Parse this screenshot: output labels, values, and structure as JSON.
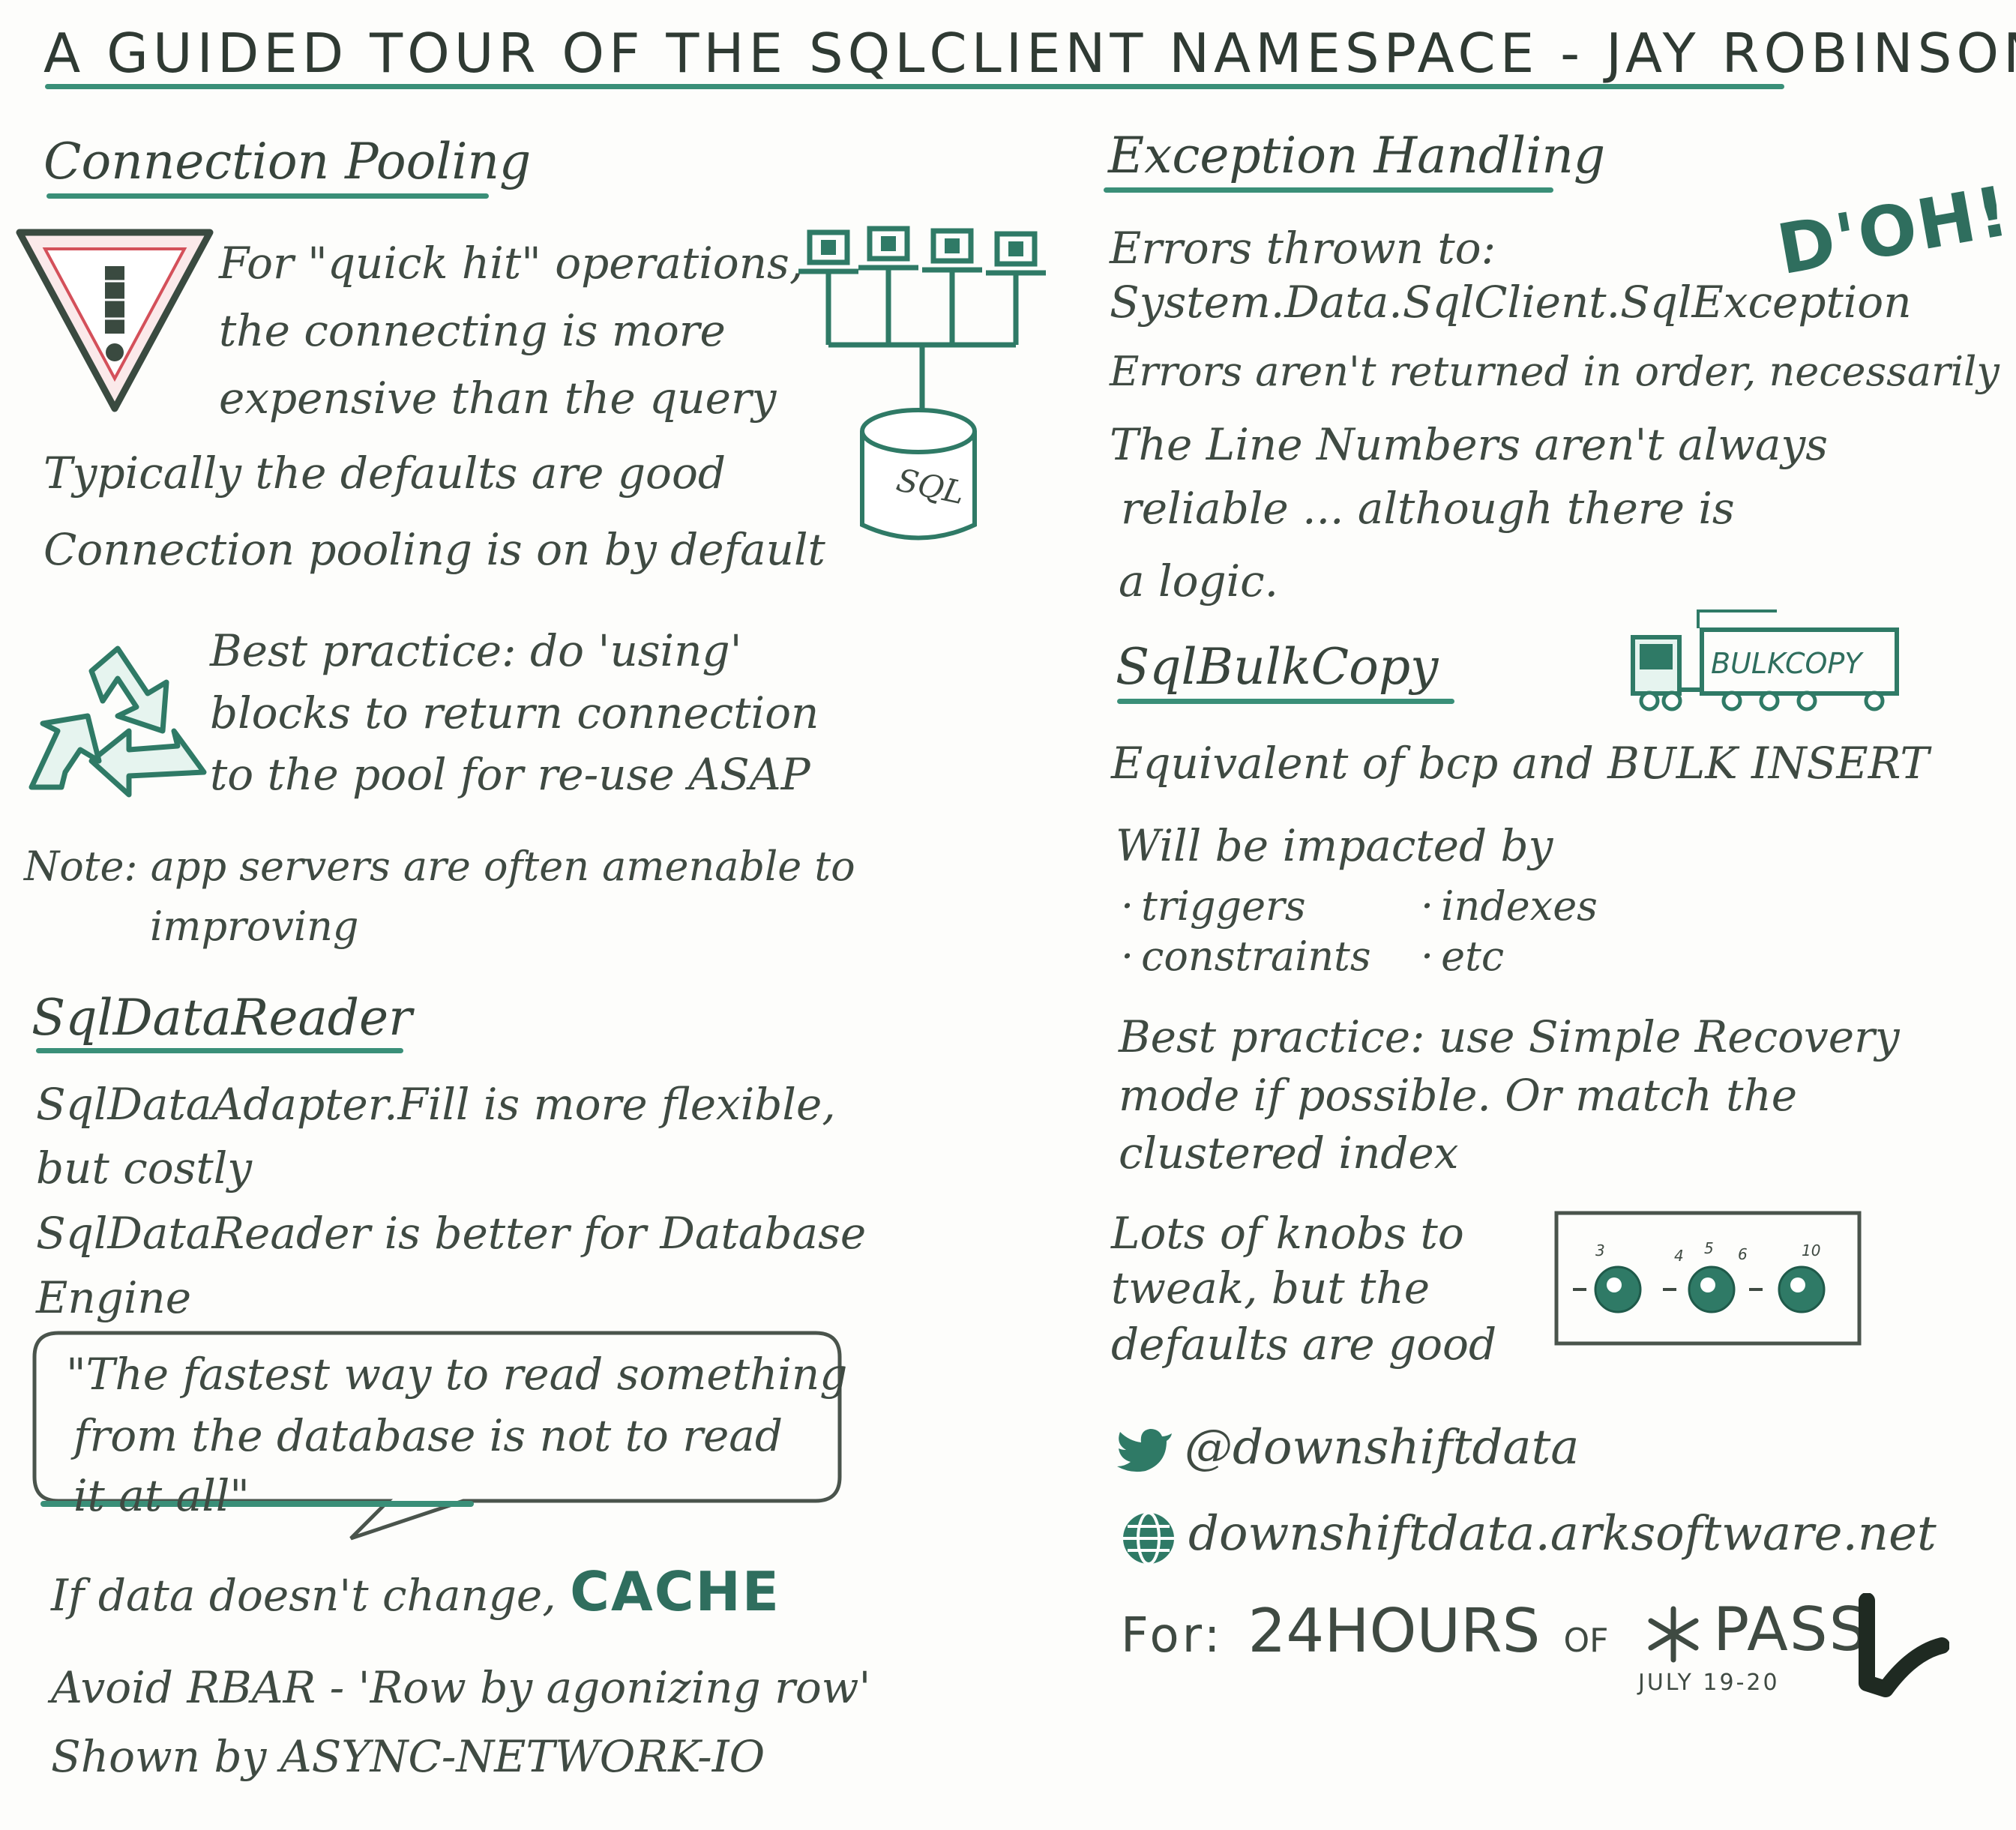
{
  "title": "A GUIDED TOUR OF THE SQLCLIENT NAMESPACE - JAY ROBINSON",
  "left": {
    "pooling": {
      "heading": "Connection Pooling",
      "quick_hit": [
        "For \"quick hit\" operations,",
        "the connecting is more",
        "expensive than the query"
      ],
      "defaults": "Typically the defaults are good",
      "on_default": "Connection pooling is on by default",
      "best_practice": [
        "Best practice: do 'using'",
        "blocks to return connection",
        "to the pool for re-use ASAP"
      ],
      "note": [
        "Note: app servers are often amenable to",
        "improving"
      ],
      "sql_label": "SQL"
    },
    "reader": {
      "heading": "SqlDataReader",
      "adapter": [
        "SqlDataAdapter.Fill is more flexible,",
        "but costly"
      ],
      "better": [
        "SqlDataReader is better for Database",
        "Engine"
      ],
      "quote": [
        "\"The fastest way to read something",
        "from the database is not to read",
        "it at all\""
      ],
      "cache_prefix": "If data doesn't change,",
      "cache_word": "CACHE",
      "rbar": "Avoid RBAR - 'Row by agonizing row'",
      "shown": "Shown by ASYNC-NETWORK-IO"
    }
  },
  "right": {
    "exceptions": {
      "heading": "Exception Handling",
      "doh": "D'OH!",
      "lines": [
        "Errors thrown to:",
        "System.Data.SqlClient.SqlException",
        "Errors aren't returned in order, necessarily",
        "The Line Numbers aren't always",
        "reliable ... although there is",
        "a logic."
      ]
    },
    "bulk": {
      "heading": "SqlBulkCopy",
      "truck_label": "BULKCOPY",
      "equivalent": "Equivalent of bcp and BULK INSERT",
      "impacted": "Will be impacted by",
      "items": [
        "triggers",
        "indexes",
        "constraints",
        "etc"
      ],
      "best_practice": [
        "Best practice: use Simple Recovery",
        "mode if possible. Or match the",
        "clustered index"
      ],
      "knobs": [
        "Lots of knobs to",
        "tweak, but the",
        "defaults are good"
      ],
      "knob_marks": [
        "3",
        "4",
        "5",
        "6",
        "10"
      ]
    },
    "contact": {
      "twitter": "@downshiftdata",
      "web": "downshiftdata.arksoftware.net"
    },
    "event": {
      "for_label": "For:",
      "hours": "24HOURS",
      "of_label": "OF",
      "org": "PASS",
      "dates": "JULY 19-20"
    }
  },
  "colors": {
    "ink": "#3f4a42",
    "accent": "#2f7a66",
    "warning": "#d4505a"
  }
}
